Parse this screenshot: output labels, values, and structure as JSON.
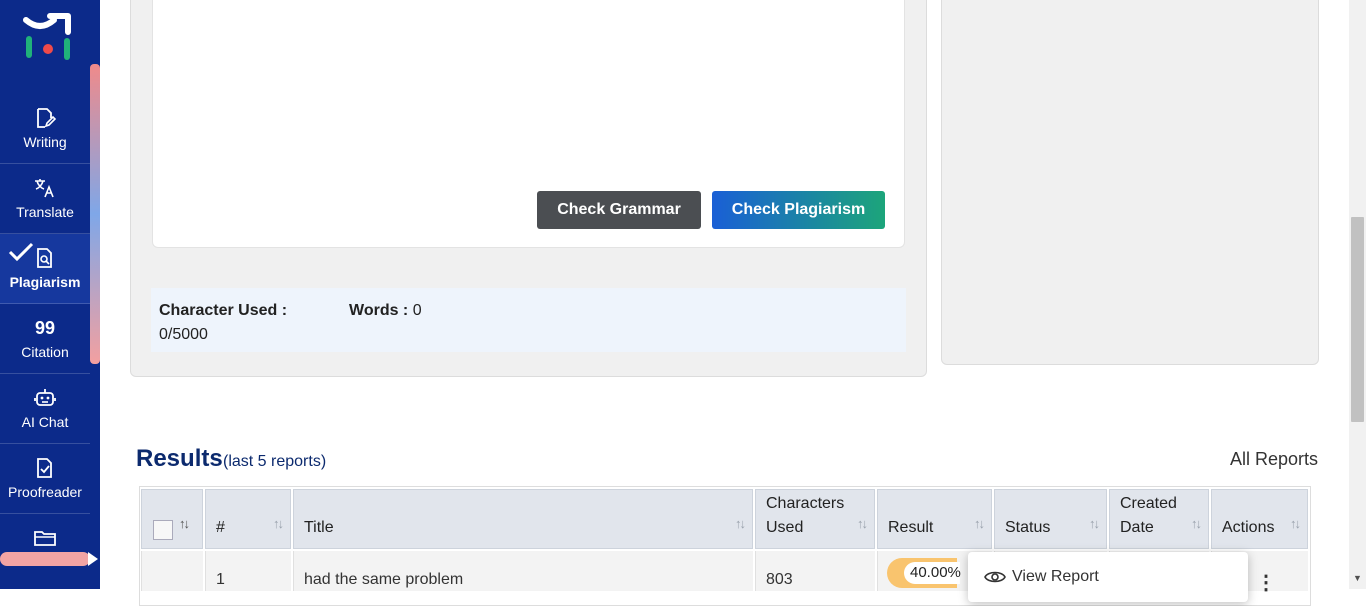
{
  "sidebar": {
    "items": [
      {
        "label": "Writing",
        "icon": "edit-document-icon"
      },
      {
        "label": "Translate",
        "icon": "translate-icon"
      },
      {
        "label": "Plagiarism",
        "icon": "document-search-icon",
        "active": true
      },
      {
        "label": "Citation",
        "icon": "quote-icon",
        "glyph": "99"
      },
      {
        "label": "AI Chat",
        "icon": "robot-icon"
      },
      {
        "label": "Proofreader",
        "icon": "document-check-icon"
      },
      {
        "label": "",
        "icon": "folder-icon"
      }
    ]
  },
  "editor": {
    "check_grammar_label": "Check Grammar",
    "check_plagiarism_label": "Check Plagiarism"
  },
  "stats": {
    "characters_label": "Character Used :",
    "characters_value": "0/5000",
    "words_label": "Words :",
    "words_value": "0"
  },
  "results": {
    "title": "Results",
    "subtitle": "(last 5 reports)",
    "all_reports_label": "All Reports",
    "columns": [
      "#",
      "Title",
      "Characters Used",
      "Result",
      "Status",
      "Created Date",
      "Actions"
    ],
    "column_lines": {
      "characters": [
        "Characters",
        "Used"
      ],
      "created": [
        "Created",
        "Date"
      ]
    },
    "rows": [
      {
        "index": "1",
        "title": "had the same problem",
        "characters": "803",
        "result": "40.00%"
      }
    ]
  },
  "row_menu": {
    "view_report_label": "View Report"
  },
  "colors": {
    "sidebar": "#0c2a8a",
    "accent_blue": "#1a5fd6",
    "accent_green": "#1ca57a",
    "result_pill": "#f9c46e"
  }
}
